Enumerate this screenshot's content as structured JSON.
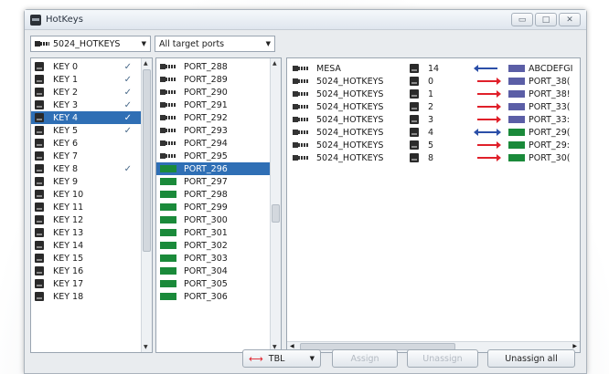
{
  "window": {
    "title": "HotKeys",
    "controls": [
      "▭",
      "□",
      "✕"
    ]
  },
  "toolbar": {
    "device_combo": "5024_HOTKEYS",
    "ports_combo": "All target ports"
  },
  "keys": [
    {
      "label": "KEY 0",
      "checked": true
    },
    {
      "label": "KEY 1",
      "checked": true
    },
    {
      "label": "KEY 2",
      "checked": true
    },
    {
      "label": "KEY 3",
      "checked": true
    },
    {
      "label": "KEY 4",
      "checked": true,
      "selected": true
    },
    {
      "label": "KEY 5",
      "checked": true
    },
    {
      "label": "KEY 6",
      "checked": false
    },
    {
      "label": "KEY 7",
      "checked": false
    },
    {
      "label": "KEY 8",
      "checked": true
    },
    {
      "label": "KEY 9",
      "checked": false
    },
    {
      "label": "KEY 10",
      "checked": false
    },
    {
      "label": "KEY 11",
      "checked": false
    },
    {
      "label": "KEY 12",
      "checked": false
    },
    {
      "label": "KEY 13",
      "checked": false
    },
    {
      "label": "KEY 14",
      "checked": false
    },
    {
      "label": "KEY 15",
      "checked": false
    },
    {
      "label": "KEY 16",
      "checked": false
    },
    {
      "label": "KEY 17",
      "checked": false
    },
    {
      "label": "KEY 18",
      "checked": false
    }
  ],
  "ports": [
    {
      "label": "PORT_288",
      "kind": "device"
    },
    {
      "label": "PORT_289",
      "kind": "device"
    },
    {
      "label": "PORT_290",
      "kind": "device"
    },
    {
      "label": "PORT_291",
      "kind": "device"
    },
    {
      "label": "PORT_292",
      "kind": "device"
    },
    {
      "label": "PORT_293",
      "kind": "device"
    },
    {
      "label": "PORT_294",
      "kind": "device"
    },
    {
      "label": "PORT_295",
      "kind": "device"
    },
    {
      "label": "PORT_296",
      "kind": "green",
      "selected": true
    },
    {
      "label": "PORT_297",
      "kind": "green"
    },
    {
      "label": "PORT_298",
      "kind": "green"
    },
    {
      "label": "PORT_299",
      "kind": "green"
    },
    {
      "label": "PORT_300",
      "kind": "green"
    },
    {
      "label": "PORT_301",
      "kind": "green"
    },
    {
      "label": "PORT_302",
      "kind": "green"
    },
    {
      "label": "PORT_303",
      "kind": "green"
    },
    {
      "label": "PORT_304",
      "kind": "green"
    },
    {
      "label": "PORT_305",
      "kind": "green"
    },
    {
      "label": "PORT_306",
      "kind": "green"
    }
  ],
  "assignments": [
    {
      "source": "MESA",
      "key": "14",
      "direction": "left",
      "arrow_color": "#2b4fa8",
      "target_color": "#5b5ea6",
      "target": "ABCDEFGI"
    },
    {
      "source": "5024_HOTKEYS",
      "key": "0",
      "direction": "right",
      "arrow_color": "#e0202a",
      "target_color": "#5b5ea6",
      "target": "PORT_38("
    },
    {
      "source": "5024_HOTKEYS",
      "key": "1",
      "direction": "right",
      "arrow_color": "#e0202a",
      "target_color": "#5b5ea6",
      "target": "PORT_38!"
    },
    {
      "source": "5024_HOTKEYS",
      "key": "2",
      "direction": "right",
      "arrow_color": "#e0202a",
      "target_color": "#5b5ea6",
      "target": "PORT_33("
    },
    {
      "source": "5024_HOTKEYS",
      "key": "3",
      "direction": "right",
      "arrow_color": "#e0202a",
      "target_color": "#5b5ea6",
      "target": "PORT_33:"
    },
    {
      "source": "5024_HOTKEYS",
      "key": "4",
      "direction": "both",
      "arrow_color": "#2b4fa8",
      "target_color": "#1a8a3a",
      "target": "PORT_29("
    },
    {
      "source": "5024_HOTKEYS",
      "key": "5",
      "direction": "right",
      "arrow_color": "#e0202a",
      "target_color": "#1a8a3a",
      "target": "PORT_29:"
    },
    {
      "source": "5024_HOTKEYS",
      "key": "8",
      "direction": "right",
      "arrow_color": "#e0202a",
      "target_color": "#1a8a3a",
      "target": "PORT_30("
    }
  ],
  "bottom": {
    "mode_label": "TBL",
    "assign_label": "Assign",
    "unassign_label": "Unassign",
    "unassign_all_label": "Unassign all"
  }
}
